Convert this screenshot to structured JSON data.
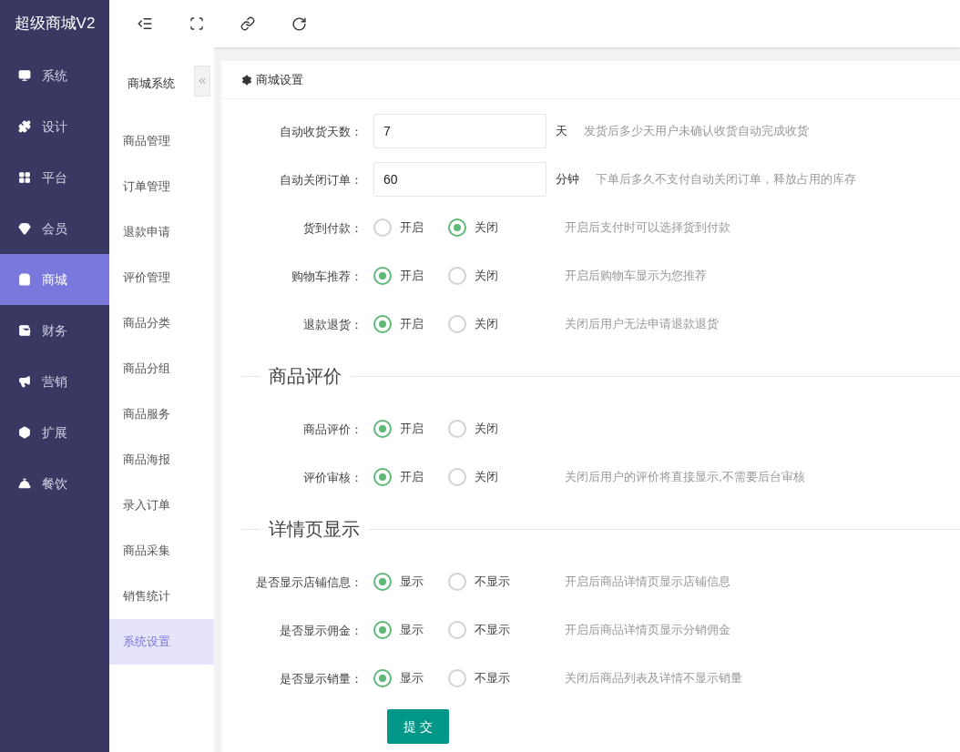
{
  "brand": "超级商城V2",
  "nav": [
    {
      "label": "系统",
      "selected": false
    },
    {
      "label": "设计",
      "selected": false
    },
    {
      "label": "平台",
      "selected": false
    },
    {
      "label": "会员",
      "selected": false
    },
    {
      "label": "商城",
      "selected": true
    },
    {
      "label": "财务",
      "selected": false
    },
    {
      "label": "营销",
      "selected": false
    },
    {
      "label": "扩展",
      "selected": false
    },
    {
      "label": "餐饮",
      "selected": false
    }
  ],
  "subnav": {
    "title": "商城系统",
    "items": [
      {
        "label": "商品管理",
        "selected": false
      },
      {
        "label": "订单管理",
        "selected": false
      },
      {
        "label": "退款申请",
        "selected": false
      },
      {
        "label": "评价管理",
        "selected": false
      },
      {
        "label": "商品分类",
        "selected": false
      },
      {
        "label": "商品分组",
        "selected": false
      },
      {
        "label": "商品服务",
        "selected": false
      },
      {
        "label": "商品海报",
        "selected": false
      },
      {
        "label": "录入订单",
        "selected": false
      },
      {
        "label": "商品采集",
        "selected": false
      },
      {
        "label": "销售统计",
        "selected": false
      },
      {
        "label": "系统设置",
        "selected": true
      }
    ]
  },
  "card_title": "商城设置",
  "sections": [
    {
      "rows": [
        {
          "kind": "input",
          "label": "自动收货天数：",
          "value": "7",
          "unit": "天",
          "hint": "发货后多少天用户未确认收货自动完成收货"
        },
        {
          "kind": "input",
          "label": "自动关闭订单：",
          "value": "60",
          "unit": "分钟",
          "hint": "下单后多久不支付自动关闭订单，释放占用的库存"
        },
        {
          "kind": "radio",
          "label": "货到付款：",
          "options": [
            {
              "label": "开启",
              "selected": false
            },
            {
              "label": "关闭",
              "selected": true
            }
          ],
          "hint": "开启后支付时可以选择货到付款"
        },
        {
          "kind": "radio",
          "label": "购物车推荐：",
          "options": [
            {
              "label": "开启",
              "selected": true
            },
            {
              "label": "关闭",
              "selected": false
            }
          ],
          "hint": "开启后购物车显示为您推荐"
        },
        {
          "kind": "radio",
          "label": "退款退货：",
          "options": [
            {
              "label": "开启",
              "selected": true
            },
            {
              "label": "关闭",
              "selected": false
            }
          ],
          "hint": "关闭后用户无法申请退款退货"
        }
      ]
    },
    {
      "heading": "商品评价",
      "rows": [
        {
          "kind": "radio",
          "label": "商品评价：",
          "options": [
            {
              "label": "开启",
              "selected": true
            },
            {
              "label": "关闭",
              "selected": false
            }
          ]
        },
        {
          "kind": "radio",
          "label": "评价审核：",
          "options": [
            {
              "label": "开启",
              "selected": true
            },
            {
              "label": "关闭",
              "selected": false
            }
          ],
          "hint": "关闭后用户的评价将直接显示,不需要后台审核"
        }
      ]
    },
    {
      "heading": "详情页显示",
      "rows": [
        {
          "kind": "radio",
          "label": "是否显示店铺信息：",
          "options": [
            {
              "label": "显示",
              "selected": true
            },
            {
              "label": "不显示",
              "selected": false
            }
          ],
          "hint": "开启后商品详情页显示店铺信息"
        },
        {
          "kind": "radio",
          "label": "是否显示佣金：",
          "options": [
            {
              "label": "显示",
              "selected": true
            },
            {
              "label": "不显示",
              "selected": false
            }
          ],
          "hint": "开启后商品详情页显示分销佣金"
        },
        {
          "kind": "radio",
          "label": "是否显示销量：",
          "options": [
            {
              "label": "显示",
              "selected": true
            },
            {
              "label": "不显示",
              "selected": false
            }
          ],
          "hint": "关闭后商品列表及详情不显示销量"
        }
      ]
    }
  ],
  "submit": "提 交"
}
